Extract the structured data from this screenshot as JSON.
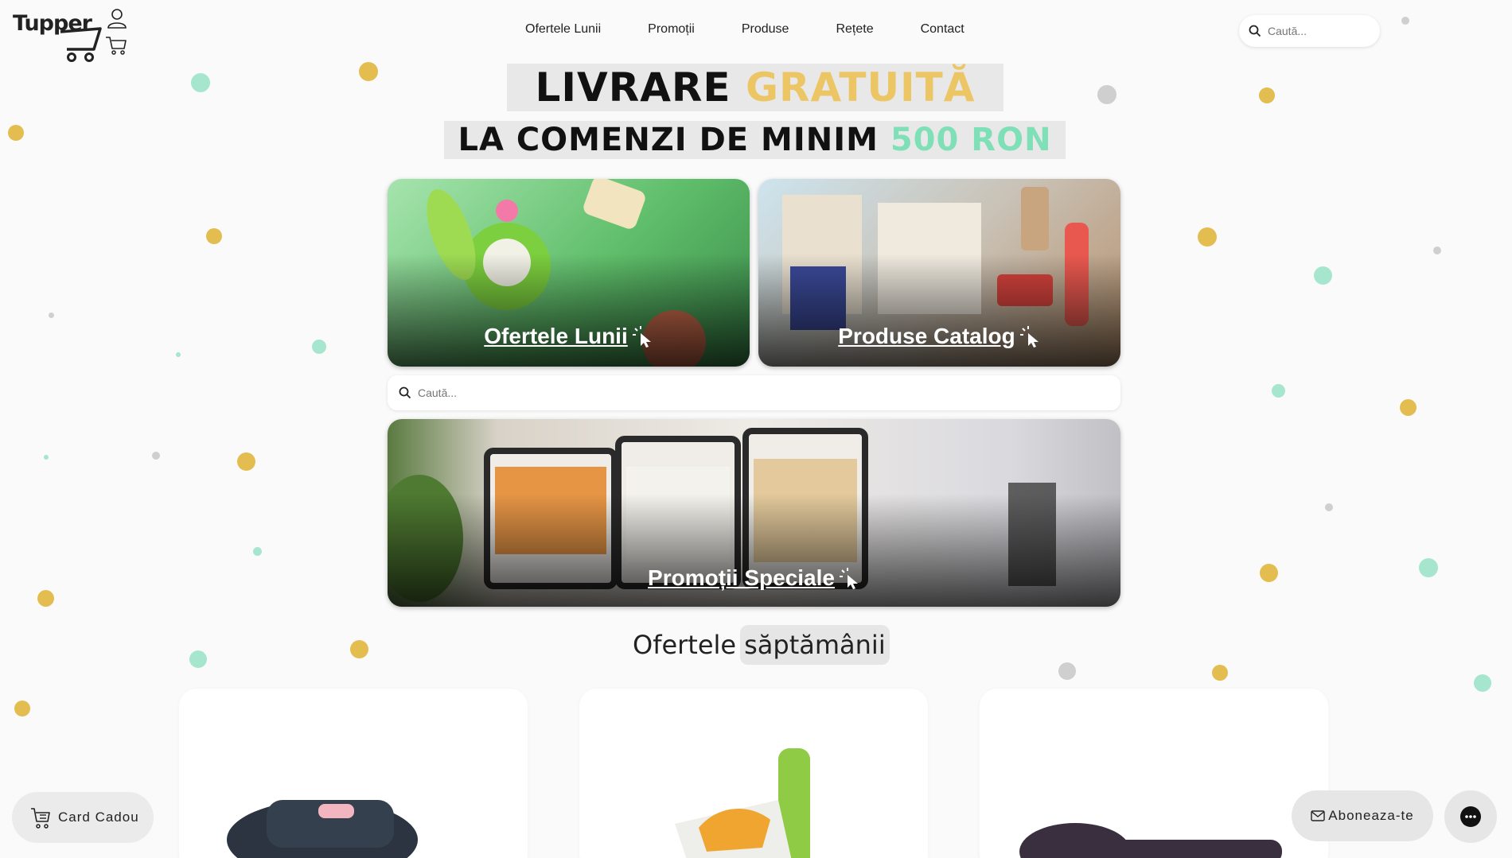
{
  "brand": {
    "logo_text": "Tupper"
  },
  "header": {
    "nav": [
      "Ofertele Lunii",
      "Promoții",
      "Produse",
      "Rețete",
      "Contact"
    ],
    "search_placeholder": "Caută..."
  },
  "banner": {
    "line1_dark": "LIVRARE",
    "line1_accent": "GRATUITĂ",
    "line2_dark": "LA COMENZI DE MINIM",
    "line2_accent": "500 RON",
    "accent_gold": "#ecc564",
    "accent_mint": "#7fe0b8"
  },
  "tiles": {
    "offers_label": "Ofertele Lunii",
    "catalog_label": "Produse Catalog",
    "promos_label": "Promoții Speciale",
    "search_placeholder": "Caută..."
  },
  "weekly": {
    "title_plain": "Ofertele",
    "title_highlight": "săptămânii"
  },
  "floating": {
    "gift_card_label": "Card Cadou",
    "subscribe_label": "Aboneaza-te"
  },
  "icons": [
    "cart-logo-icon",
    "user-icon",
    "cart-icon",
    "search-icon",
    "cursor-click-icon",
    "gift-cart-icon",
    "mail-icon",
    "chat-icon"
  ]
}
